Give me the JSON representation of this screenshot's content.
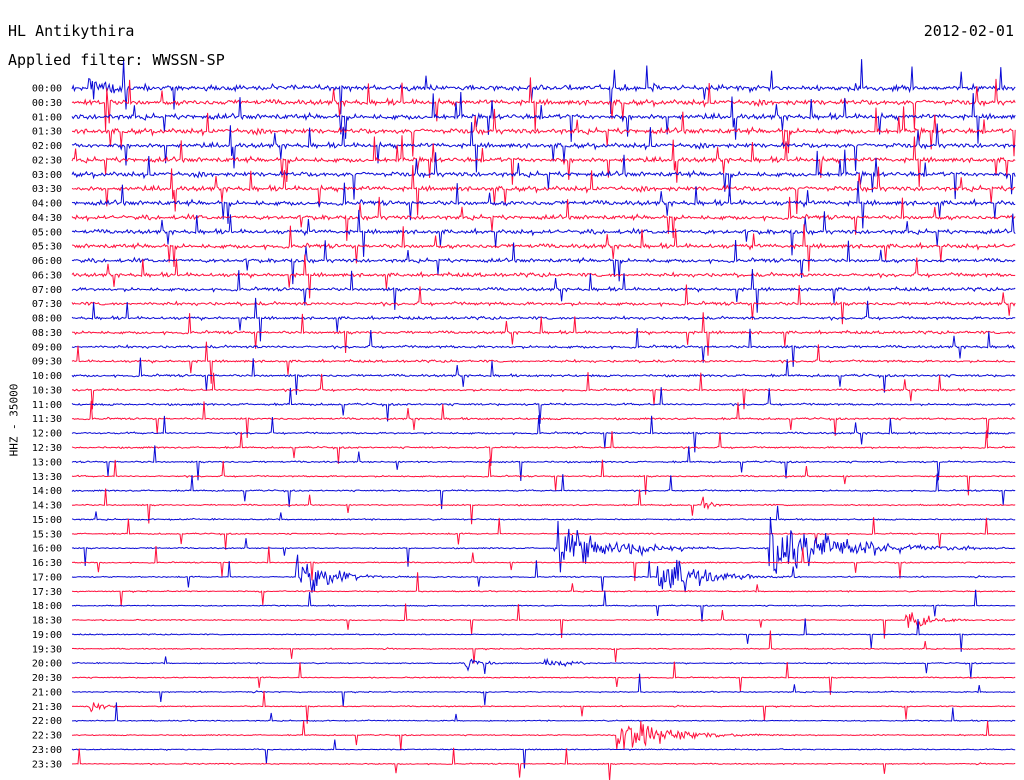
{
  "header": {
    "station": "HL Antikythira",
    "date": "2012-02-01",
    "filter_label": "Applied filter:",
    "filter_name": "WWSSN-SP"
  },
  "channel_label": "HHZ - 35000",
  "colors": {
    "trace_a": "#ff0f3c",
    "trace_b": "#0a0ad6",
    "background": "#ffffff",
    "text": "#000000"
  },
  "chart_data": {
    "type": "line",
    "subtype": "helicorder",
    "title": "HL Antikythira",
    "date": "2012-02-01",
    "filter": "WWSSN-SP",
    "channel": "HHZ - 35000",
    "row_minutes": 30,
    "rows": [
      {
        "time": "00:00",
        "color": "trace_b",
        "noise": 0.55,
        "spikes": 0.35
      },
      {
        "time": "00:30",
        "color": "trace_a",
        "noise": 0.55,
        "spikes": 0.35
      },
      {
        "time": "01:00",
        "color": "trace_b",
        "noise": 0.55,
        "spikes": 0.3
      },
      {
        "time": "01:30",
        "color": "trace_a",
        "noise": 0.55,
        "spikes": 0.3
      },
      {
        "time": "02:00",
        "color": "trace_b",
        "noise": 0.5,
        "spikes": 0.3
      },
      {
        "time": "02:30",
        "color": "trace_a",
        "noise": 0.5,
        "spikes": 0.3
      },
      {
        "time": "03:00",
        "color": "trace_b",
        "noise": 0.5,
        "spikes": 0.3
      },
      {
        "time": "03:30",
        "color": "trace_a",
        "noise": 0.5,
        "spikes": 0.3
      },
      {
        "time": "04:00",
        "color": "trace_b",
        "noise": 0.5,
        "spikes": 0.25
      },
      {
        "time": "04:30",
        "color": "trace_a",
        "noise": 0.45,
        "spikes": 0.25
      },
      {
        "time": "05:00",
        "color": "trace_b",
        "noise": 0.45,
        "spikes": 0.25
      },
      {
        "time": "05:30",
        "color": "trace_a",
        "noise": 0.45,
        "spikes": 0.25
      },
      {
        "time": "06:00",
        "color": "trace_b",
        "noise": 0.4,
        "spikes": 0.25
      },
      {
        "time": "06:30",
        "color": "trace_a",
        "noise": 0.4,
        "spikes": 0.2
      },
      {
        "time": "07:00",
        "color": "trace_b",
        "noise": 0.35,
        "spikes": 0.2
      },
      {
        "time": "07:30",
        "color": "trace_a",
        "noise": 0.35,
        "spikes": 0.2
      },
      {
        "time": "08:00",
        "color": "trace_b",
        "noise": 0.3,
        "spikes": 0.2
      },
      {
        "time": "08:30",
        "color": "trace_a",
        "noise": 0.3,
        "spikes": 0.2
      },
      {
        "time": "09:00",
        "color": "trace_b",
        "noise": 0.28,
        "spikes": 0.18
      },
      {
        "time": "09:30",
        "color": "trace_a",
        "noise": 0.25,
        "spikes": 0.18
      },
      {
        "time": "10:00",
        "color": "trace_b",
        "noise": 0.25,
        "spikes": 0.15
      },
      {
        "time": "10:30",
        "color": "trace_a",
        "noise": 0.22,
        "spikes": 0.15
      },
      {
        "time": "11:00",
        "color": "trace_b",
        "noise": 0.22,
        "spikes": 0.15
      },
      {
        "time": "11:30",
        "color": "trace_a",
        "noise": 0.2,
        "spikes": 0.15
      },
      {
        "time": "12:00",
        "color": "trace_b",
        "noise": 0.2,
        "spikes": 0.15
      },
      {
        "time": "12:30",
        "color": "trace_a",
        "noise": 0.18,
        "spikes": 0.12
      },
      {
        "time": "13:00",
        "color": "trace_b",
        "noise": 0.18,
        "spikes": 0.12
      },
      {
        "time": "13:30",
        "color": "trace_a",
        "noise": 0.16,
        "spikes": 0.12
      },
      {
        "time": "14:00",
        "color": "trace_b",
        "noise": 0.16,
        "spikes": 0.12
      },
      {
        "time": "14:30",
        "color": "trace_a",
        "noise": 0.15,
        "spikes": 0.12
      },
      {
        "time": "15:00",
        "color": "trace_b",
        "noise": 0.15,
        "spikes": 0.1
      },
      {
        "time": "15:30",
        "color": "trace_a",
        "noise": 0.14,
        "spikes": 0.1
      },
      {
        "time": "16:00",
        "color": "trace_b",
        "noise": 0.14,
        "spikes": 0.1
      },
      {
        "time": "16:30",
        "color": "trace_a",
        "noise": 0.13,
        "spikes": 0.1
      },
      {
        "time": "17:00",
        "color": "trace_b",
        "noise": 0.13,
        "spikes": 0.1
      },
      {
        "time": "17:30",
        "color": "trace_a",
        "noise": 0.13,
        "spikes": 0.1
      },
      {
        "time": "18:00",
        "color": "trace_b",
        "noise": 0.12,
        "spikes": 0.1
      },
      {
        "time": "18:30",
        "color": "trace_a",
        "noise": 0.12,
        "spikes": 0.1
      },
      {
        "time": "19:00",
        "color": "trace_b",
        "noise": 0.12,
        "spikes": 0.08
      },
      {
        "time": "19:30",
        "color": "trace_a",
        "noise": 0.12,
        "spikes": 0.08
      },
      {
        "time": "20:00",
        "color": "trace_b",
        "noise": 0.12,
        "spikes": 0.08
      },
      {
        "time": "20:30",
        "color": "trace_a",
        "noise": 0.12,
        "spikes": 0.08
      },
      {
        "time": "21:00",
        "color": "trace_b",
        "noise": 0.12,
        "spikes": 0.08
      },
      {
        "time": "21:30",
        "color": "trace_a",
        "noise": 0.12,
        "spikes": 0.08
      },
      {
        "time": "22:00",
        "color": "trace_b",
        "noise": 0.12,
        "spikes": 0.08
      },
      {
        "time": "22:30",
        "color": "trace_a",
        "noise": 0.12,
        "spikes": 0.08
      },
      {
        "time": "23:00",
        "color": "trace_b",
        "noise": 0.12,
        "spikes": 0.08
      },
      {
        "time": "23:30",
        "color": "trace_a",
        "noise": 0.12,
        "spikes": 0.08
      }
    ],
    "events": [
      {
        "row": 0,
        "minute": 0.5,
        "duration_min": 1.0,
        "amplitude": 1.2
      },
      {
        "row": 29,
        "minute": 20.0,
        "duration_min": 0.3,
        "amplitude": 0.9
      },
      {
        "row": 32,
        "minute": 15.3,
        "duration_min": 2.0,
        "amplitude": 2.6
      },
      {
        "row": 32,
        "minute": 22.1,
        "duration_min": 2.6,
        "amplitude": 3.2
      },
      {
        "row": 34,
        "minute": 7.1,
        "duration_min": 1.2,
        "amplitude": 2.2
      },
      {
        "row": 34,
        "minute": 18.6,
        "duration_min": 1.5,
        "amplitude": 2.4
      },
      {
        "row": 37,
        "minute": 26.5,
        "duration_min": 1.0,
        "amplitude": 0.8
      },
      {
        "row": 40,
        "minute": 12.5,
        "duration_min": 0.5,
        "amplitude": 1.0
      },
      {
        "row": 40,
        "minute": 15.0,
        "duration_min": 1.0,
        "amplitude": 0.5
      },
      {
        "row": 43,
        "minute": 0.5,
        "duration_min": 0.5,
        "amplitude": 0.6
      },
      {
        "row": 45,
        "minute": 17.3,
        "duration_min": 1.8,
        "amplitude": 2.0
      }
    ],
    "xlabel": "",
    "ylabel": "HHZ - 35000"
  }
}
